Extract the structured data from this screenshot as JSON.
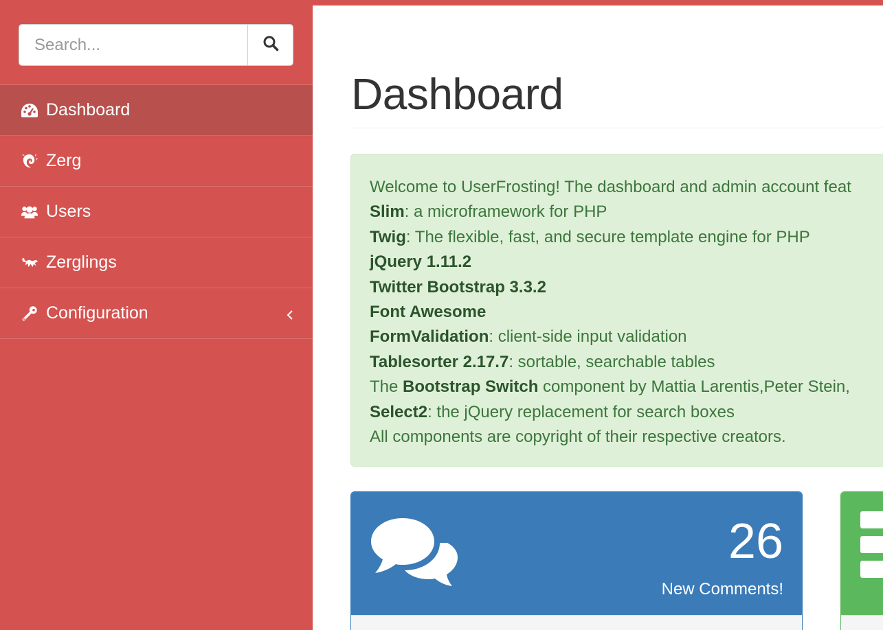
{
  "sidebar": {
    "search": {
      "placeholder": "Search..."
    },
    "items": [
      {
        "label": "Dashboard",
        "icon": "dashboard-icon",
        "active": true
      },
      {
        "label": "Zerg",
        "icon": "zerg-icon",
        "active": false
      },
      {
        "label": "Users",
        "icon": "users-icon",
        "active": false
      },
      {
        "label": "Zerglings",
        "icon": "zergling-icon",
        "active": false
      },
      {
        "label": "Configuration",
        "icon": "wrench-icon",
        "active": false,
        "has_submenu": true
      }
    ]
  },
  "main": {
    "title": "Dashboard",
    "alert": {
      "intro": "Welcome to UserFrosting! The dashboard and admin account feat",
      "slim_name": "Slim",
      "slim_desc": ": a microframework for PHP",
      "twig_name": "Twig",
      "twig_desc": ": The flexible, fast, and secure template engine for PHP",
      "jquery": "jQuery 1.11.2",
      "bootstrap": "Twitter Bootstrap 3.3.2",
      "fontawesome": "Font Awesome",
      "formvalidation_name": "FormValidation",
      "formvalidation_desc": ": client-side input validation",
      "tablesorter_name": "Tablesorter 2.17.7",
      "tablesorter_desc": ": sortable, searchable tables",
      "switch_pre": "The ",
      "switch_name": "Bootstrap Switch",
      "switch_desc": " component by Mattia Larentis,Peter Stein,",
      "select2_name": "Select2",
      "select2_desc": ": the jQuery replacement for search boxes",
      "copyright": "All components are copyright of their respective creators."
    },
    "panels": [
      {
        "count": "26",
        "label": "New Comments!",
        "icon": "comments-icon",
        "color": "#3a7bb8"
      },
      {
        "icon": "list-icon",
        "color": "#5cb85c"
      }
    ]
  },
  "colors": {
    "sidebar_bg": "#d4524f",
    "sidebar_active": "#b8504d",
    "alert_bg": "#dff0d8",
    "alert_text": "#3c763d",
    "panel_primary": "#3a7bb8",
    "panel_success": "#5cb85c"
  }
}
